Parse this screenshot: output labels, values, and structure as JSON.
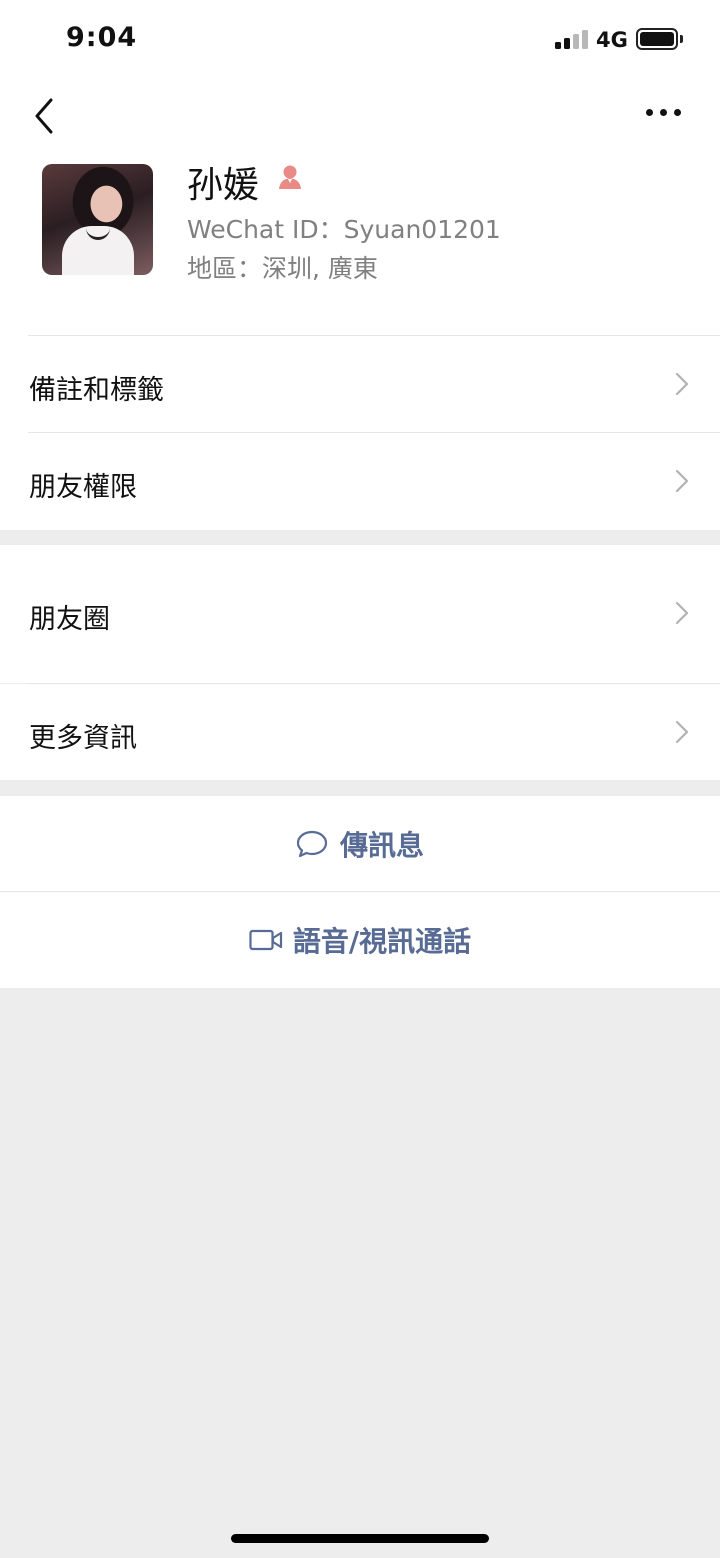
{
  "status_bar": {
    "time": "9:04",
    "network": "4G",
    "icons": [
      "signal-icon",
      "battery-icon"
    ]
  },
  "nav": {
    "icons": [
      "back-icon",
      "more-icon"
    ]
  },
  "profile": {
    "name": "孙媛",
    "wechat_id": "WeChat ID：Syuan01201",
    "region": "地區：深圳, 廣東",
    "gender_icon": "female-icon",
    "gender_color": "#e98a86"
  },
  "menu": {
    "notes_tags": "備註和標籤",
    "friend_permissions": "朋友權限",
    "moments": "朋友圈",
    "more_info": "更多資訊"
  },
  "actions": {
    "send_message": "傳訊息",
    "voice_video_call": "語音/視訊通話",
    "message_icon": "chat-bubble-icon",
    "call_icon": "video-camera-icon"
  },
  "colors": {
    "link": "#576b95",
    "background": "#ededed",
    "secondary_text": "#808080"
  }
}
